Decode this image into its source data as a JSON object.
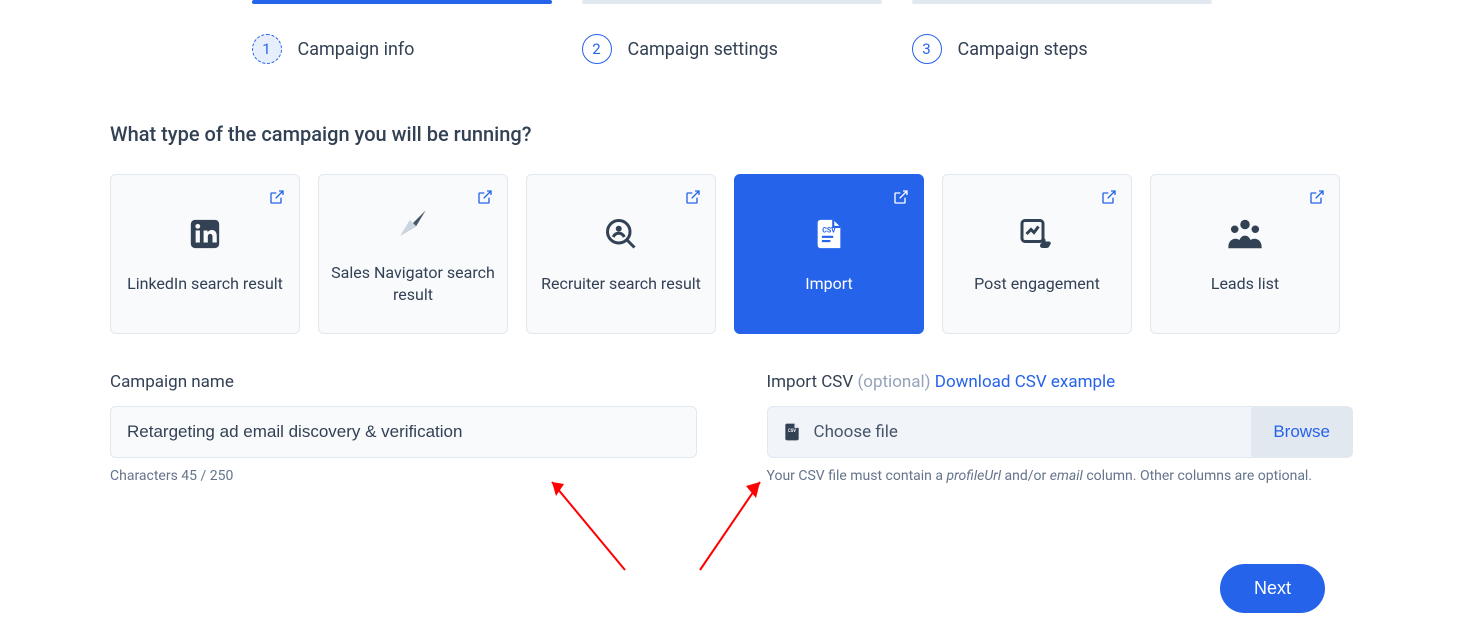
{
  "stepper": {
    "steps": [
      {
        "num": "1",
        "label": "Campaign info"
      },
      {
        "num": "2",
        "label": "Campaign settings"
      },
      {
        "num": "3",
        "label": "Campaign steps"
      }
    ]
  },
  "heading": "What type of the campaign you will be running?",
  "campaignTypes": [
    {
      "label": "LinkedIn search result"
    },
    {
      "label": "Sales Navigator search result"
    },
    {
      "label": "Recruiter search result"
    },
    {
      "label": "Import"
    },
    {
      "label": "Post engagement"
    },
    {
      "label": "Leads list"
    }
  ],
  "campaignName": {
    "label": "Campaign name",
    "value": "Retargeting ad email discovery & verification",
    "helper": "Characters 45 / 250"
  },
  "importCsv": {
    "label": "Import CSV",
    "optional": "(optional)",
    "exampleLink": "Download CSV example",
    "choosePlaceholder": "Choose file",
    "browse": "Browse",
    "helper_prefix": "Your CSV file must contain a ",
    "helper_em1": "profileUrl",
    "helper_mid": " and/or ",
    "helper_em2": "email",
    "helper_suffix": " column. Other columns are optional."
  },
  "next": "Next"
}
